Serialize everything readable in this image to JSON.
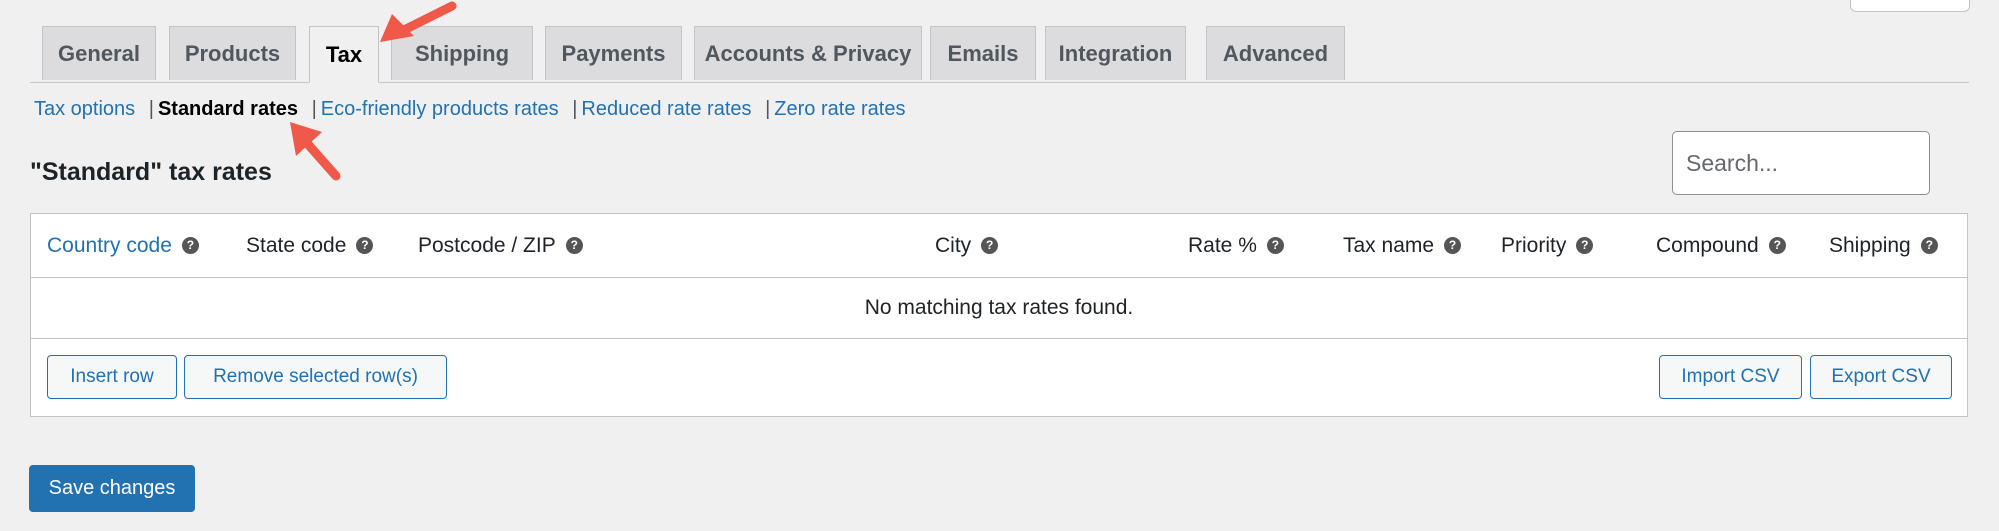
{
  "tabs": [
    {
      "label": "General",
      "active": false
    },
    {
      "label": "Products",
      "active": false
    },
    {
      "label": "Tax",
      "active": true
    },
    {
      "label": "Shipping",
      "active": false
    },
    {
      "label": "Payments",
      "active": false
    },
    {
      "label": "Accounts & Privacy",
      "active": false
    },
    {
      "label": "Emails",
      "active": false
    },
    {
      "label": "Integration",
      "active": false
    },
    {
      "label": "Advanced",
      "active": false
    }
  ],
  "subnav": {
    "items": [
      {
        "label": "Tax options",
        "current": false
      },
      {
        "label": "Standard rates",
        "current": true
      },
      {
        "label": "Eco-friendly products rates",
        "current": false
      },
      {
        "label": "Reduced rate rates",
        "current": false
      },
      {
        "label": "Zero rate rates",
        "current": false
      }
    ],
    "separator": "|"
  },
  "section": {
    "title": "\"Standard\" tax rates",
    "search_placeholder": "Search..."
  },
  "table": {
    "columns": [
      {
        "label": "Country code",
        "sortable": true
      },
      {
        "label": "State code"
      },
      {
        "label": "Postcode / ZIP"
      },
      {
        "label": "City"
      },
      {
        "label": "Rate %"
      },
      {
        "label": "Tax name"
      },
      {
        "label": "Priority"
      },
      {
        "label": "Compound"
      },
      {
        "label": "Shipping"
      }
    ],
    "help_glyph": "?",
    "empty_message": "No matching tax rates found."
  },
  "actions": {
    "insert_row": "Insert row",
    "remove_rows": "Remove selected row(s)",
    "import_csv": "Import CSV",
    "export_csv": "Export CSV"
  },
  "save_label": "Save changes",
  "colors": {
    "accent": "#2271b1",
    "annotation_arrow": "#f0584a"
  }
}
